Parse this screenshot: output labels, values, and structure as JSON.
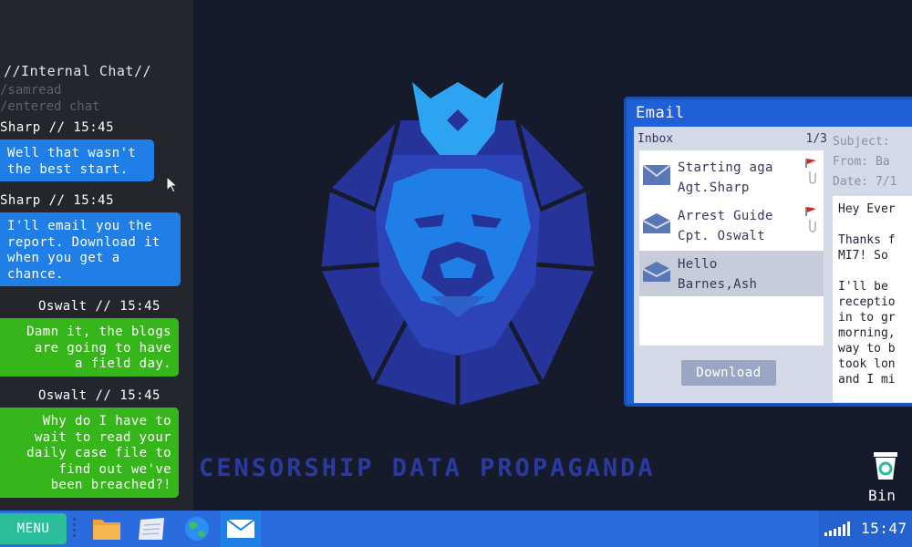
{
  "chat": {
    "header": "//Internal Chat//",
    "sys_lines": [
      "/samread",
      "/entered chat"
    ],
    "messages": [
      {
        "who": "Sharp // 15:45",
        "lines": [
          "Well that wasn't",
          "the best start."
        ],
        "color": "blue"
      },
      {
        "who": "Sharp // 15:45",
        "lines": [
          "I'll email you the",
          "report. Download it",
          "when you get a",
          "chance."
        ],
        "color": "blue"
      },
      {
        "who": "Oswalt // 15:45",
        "lines": [
          "Damn it, the blogs",
          "are going to have",
          "a field day."
        ],
        "color": "green"
      },
      {
        "who": "Oswalt // 15:45",
        "lines": [
          "Why do I have to",
          "wait to read your",
          "daily case file to",
          "find out we've",
          "been breached?!"
        ],
        "color": "green"
      }
    ]
  },
  "slogan": "CENSORSHIP DATA PROPAGANDA",
  "email": {
    "title": "Email",
    "inbox_label": "Inbox",
    "inbox_count": "1/3",
    "items": [
      {
        "subject": "Starting aga",
        "from": "Agt.Sharp",
        "icon": "envelope-closed-icon",
        "flagged": true
      },
      {
        "subject": "Arrest Guide",
        "from": "Cpt. Oswalt",
        "icon": "envelope-open-icon",
        "flagged": true
      },
      {
        "subject": "Hello",
        "from": "Barnes,Ash",
        "icon": "envelope-open-icon",
        "flagged": false
      }
    ],
    "download_label": "Download",
    "meta": {
      "subject": "Subject:",
      "from": "From: Ba",
      "date": "Date: 7/1"
    },
    "body": "Hey Ever\n\nThanks f\nMI7! So\n\nI'll be \nreceptio\nin to gr\nmorning,\nway to b\ntook lon\nand I mi"
  },
  "bin_label": "Bin",
  "taskbar": {
    "menu_label": "MENU",
    "clock": "15:47",
    "apps": [
      "folder-icon",
      "notes-icon",
      "globe-icon",
      "mail-icon"
    ]
  },
  "colors": {
    "background": "#151b2a",
    "chat_panel": "#24262e",
    "bubble_blue": "#1f7fe6",
    "bubble_green": "#36b61a",
    "taskbar": "#2a6bde",
    "menu": "#2abf9a",
    "slogan": "#2c3aa0"
  }
}
